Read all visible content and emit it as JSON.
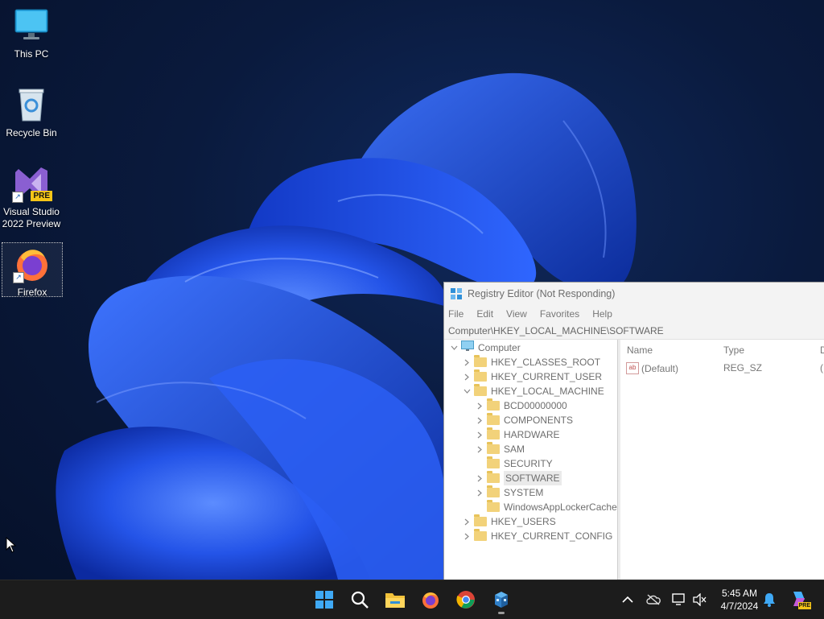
{
  "desktop": {
    "icons": [
      {
        "label": "This PC"
      },
      {
        "label": "Recycle Bin"
      },
      {
        "label": "Visual Studio\n2022 Preview",
        "badge": "PRE"
      },
      {
        "label": "Firefox"
      }
    ]
  },
  "regedit": {
    "title": "Registry Editor (Not Responding)",
    "menu": [
      "File",
      "Edit",
      "View",
      "Favorites",
      "Help"
    ],
    "address": "Computer\\HKEY_LOCAL_MACHINE\\SOFTWARE",
    "tree": [
      {
        "label": "Computer",
        "level": 0,
        "expander": "expanded",
        "icon": "computer"
      },
      {
        "label": "HKEY_CLASSES_ROOT",
        "level": 1,
        "expander": "collapsed",
        "icon": "folder"
      },
      {
        "label": "HKEY_CURRENT_USER",
        "level": 1,
        "expander": "collapsed",
        "icon": "folder"
      },
      {
        "label": "HKEY_LOCAL_MACHINE",
        "level": 1,
        "expander": "expanded",
        "icon": "folder"
      },
      {
        "label": "BCD00000000",
        "level": 2,
        "expander": "collapsed",
        "icon": "folder"
      },
      {
        "label": "COMPONENTS",
        "level": 2,
        "expander": "collapsed",
        "icon": "folder"
      },
      {
        "label": "HARDWARE",
        "level": 2,
        "expander": "collapsed",
        "icon": "folder"
      },
      {
        "label": "SAM",
        "level": 2,
        "expander": "collapsed",
        "icon": "folder"
      },
      {
        "label": "SECURITY",
        "level": 2,
        "expander": "none",
        "icon": "folder"
      },
      {
        "label": "SOFTWARE",
        "level": 2,
        "expander": "collapsed",
        "icon": "folder",
        "selected": true
      },
      {
        "label": "SYSTEM",
        "level": 2,
        "expander": "collapsed",
        "icon": "folder"
      },
      {
        "label": "WindowsAppLockerCache",
        "level": 2,
        "expander": "none",
        "icon": "folder"
      },
      {
        "label": "HKEY_USERS",
        "level": 1,
        "expander": "collapsed",
        "icon": "folder"
      },
      {
        "label": "HKEY_CURRENT_CONFIG",
        "level": 1,
        "expander": "collapsed",
        "icon": "folder"
      }
    ],
    "columns": {
      "name": "Name",
      "type": "Type",
      "data": "D"
    },
    "values": [
      {
        "name": "(Default)",
        "type": "REG_SZ",
        "data": "("
      }
    ]
  },
  "taskbar": {
    "apps": [
      "start-icon",
      "search-icon",
      "file-explorer-icon",
      "firefox-icon",
      "chrome-icon",
      "registry-editor-icon"
    ],
    "tray": [
      "chevron-up-icon",
      "onedrive-icon",
      "network-icon",
      "volume-muted-icon"
    ],
    "time": "5:45 AM",
    "date": "4/7/2024",
    "copilot_badge": "PRE"
  },
  "colors": {
    "wallpaper_dark": "#06112a",
    "bloom_blue": "#1f4fe0",
    "taskbar": "#1c1c1c",
    "folder": "#f2d27a"
  }
}
